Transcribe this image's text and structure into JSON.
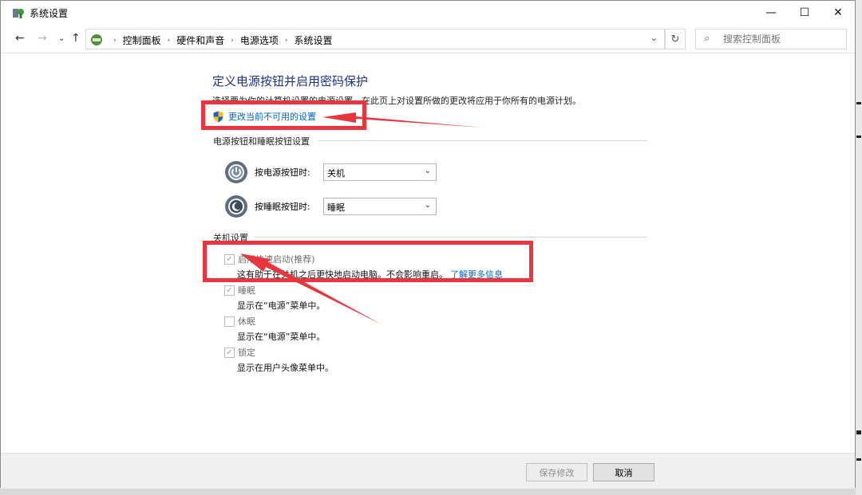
{
  "window": {
    "title": "系统设置"
  },
  "window_controls": {
    "minimize": "—",
    "maximize": "☐",
    "close": "✕"
  },
  "breadcrumb": [
    "控制面板",
    "硬件和声音",
    "电源选项",
    "系统设置"
  ],
  "search": {
    "placeholder": "搜索控制面板"
  },
  "main": {
    "heading": "定义电源按钮并启用密码保护",
    "description": "选择要为你的计算机设置的电源设置。在此页上对设置所做的更改将应用于你所有的电源计划。",
    "change_link": "更改当前不可用的设置",
    "power_group_title": "电源按钮和睡眠按钮设置",
    "power_button_label": "按电源按钮时:",
    "power_button_value": "关机",
    "sleep_button_label": "按睡眠按钮时:",
    "sleep_button_value": "睡眠",
    "shutdown_group_title": "关机设置",
    "options": [
      {
        "label": "启用快速启动(推荐)",
        "checked": true,
        "desc": "这有助于在关机之后更快地启动电脑。不会影响重启。",
        "link": "了解更多信息"
      },
      {
        "label": "睡眠",
        "checked": true,
        "desc": "显示在“电源”菜单中。"
      },
      {
        "label": "休眠",
        "checked": false,
        "desc": "显示在“电源”菜单中。"
      },
      {
        "label": "锁定",
        "checked": true,
        "desc": "显示在用户头像菜单中。"
      }
    ]
  },
  "footer": {
    "save_label": "保存修改",
    "cancel_label": "取消"
  },
  "colors": {
    "heading": "#1e3287",
    "link": "#0066cc",
    "annotation": "#e8363f"
  }
}
